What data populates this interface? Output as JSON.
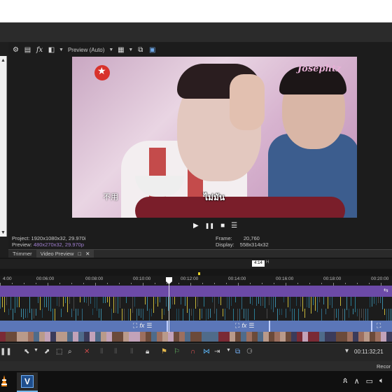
{
  "preview_toolbar": {
    "mode_label": "Preview (Auto)",
    "icons": [
      "gear-icon",
      "split-screen-icon",
      "fx-icon",
      "overlay-icon",
      "grid-icon",
      "copy-snapshot-icon",
      "save-snapshot-icon"
    ],
    "fx_label": "fx"
  },
  "video": {
    "watermark": "Josephtz",
    "caption": "ไม่มัน",
    "caption_left": "不用"
  },
  "transport": {
    "play": "▶",
    "pause": "❚❚",
    "stop": "■",
    "menu": "☰"
  },
  "info": {
    "project_label": "Project:",
    "project_value": "1920x1080x32, 29.970i",
    "preview_label": "Preview:",
    "preview_value": "480x270x32, 29.970p",
    "frame_label": "Frame:",
    "frame_value": "20,760",
    "display_label": "Display:",
    "display_value": "558x314x32"
  },
  "tabs": [
    {
      "label": "Trimmer"
    },
    {
      "label": "Video Preview"
    }
  ],
  "marker": {
    "label": "4:14",
    "letter": "H"
  },
  "ruler": {
    "labels": [
      "4:00",
      "00:06:00",
      "00:08:00",
      "00:10:00",
      "00:12:00",
      "00:14:00",
      "00:16:00",
      "00:18:00",
      "00:20:00"
    ]
  },
  "timeline": {
    "timecode": "00:11:32;21"
  },
  "status": {
    "right_text": "Recor"
  },
  "colors": {
    "video_track": "#6c4aa7",
    "second_track": "#5b76b8",
    "playhead": "#ffffff",
    "marker_yellow": "#e6d22a"
  }
}
